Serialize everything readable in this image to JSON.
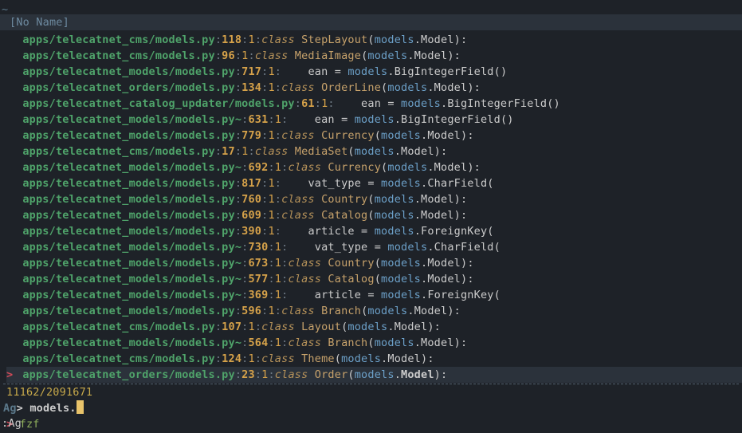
{
  "tilde": "~",
  "title": "[No Name]",
  "rows": [
    {
      "sel": false,
      "path": "apps/telecatnet_cms/models.py",
      "line": "118",
      "col": "1",
      "kind": "cls",
      "pre": "",
      "name": "StepLayout",
      "arg": "Model",
      "tail": ":"
    },
    {
      "sel": false,
      "path": "apps/telecatnet_cms/models.py",
      "line": "96",
      "col": "1",
      "kind": "cls",
      "pre": "",
      "name": "MediaImage",
      "arg": "Model",
      "tail": ":"
    },
    {
      "sel": false,
      "path": "apps/telecatnet_models/models.py",
      "line": "717",
      "col": "1",
      "kind": "assign",
      "pre": "    ",
      "ident": "ean",
      "eq": " = ",
      "attr": "BigIntegerField",
      "tail": "()"
    },
    {
      "sel": false,
      "path": "apps/telecatnet_orders/models.py",
      "line": "134",
      "col": "1",
      "kind": "cls",
      "pre": "",
      "name": "OrderLine",
      "arg": "Model",
      "tail": ":"
    },
    {
      "sel": false,
      "path": "apps/telecatnet_catalog_updater/models.py",
      "line": "61",
      "col": "1",
      "kind": "assign",
      "pre": "    ",
      "ident": "ean",
      "eq": " = ",
      "attr": "BigIntegerField",
      "tail": "()"
    },
    {
      "sel": false,
      "path": "apps/telecatnet_models/models.py~",
      "line": "631",
      "col": "1",
      "kind": "assign",
      "pre": "    ",
      "ident": "ean",
      "eq": " = ",
      "attr": "BigIntegerField",
      "tail": "()"
    },
    {
      "sel": false,
      "path": "apps/telecatnet_models/models.py",
      "line": "779",
      "col": "1",
      "kind": "cls",
      "pre": "",
      "name": "Currency",
      "arg": "Model",
      "tail": ":"
    },
    {
      "sel": false,
      "path": "apps/telecatnet_cms/models.py",
      "line": "17",
      "col": "1",
      "kind": "cls",
      "pre": "",
      "name": "MediaSet",
      "arg": "Model",
      "tail": ":"
    },
    {
      "sel": false,
      "path": "apps/telecatnet_models/models.py~",
      "line": "692",
      "col": "1",
      "kind": "cls",
      "pre": "",
      "name": "Currency",
      "arg": "Model",
      "tail": ":"
    },
    {
      "sel": false,
      "path": "apps/telecatnet_models/models.py",
      "line": "817",
      "col": "1",
      "kind": "assign",
      "pre": "    ",
      "ident": "vat_type",
      "eq": " = ",
      "attr": "CharField",
      "tail": "("
    },
    {
      "sel": false,
      "path": "apps/telecatnet_models/models.py",
      "line": "760",
      "col": "1",
      "kind": "cls",
      "pre": "",
      "name": "Country",
      "arg": "Model",
      "tail": ":"
    },
    {
      "sel": false,
      "path": "apps/telecatnet_models/models.py",
      "line": "609",
      "col": "1",
      "kind": "cls",
      "pre": "",
      "name": "Catalog",
      "arg": "Model",
      "tail": ":"
    },
    {
      "sel": false,
      "path": "apps/telecatnet_models/models.py",
      "line": "390",
      "col": "1",
      "kind": "assign",
      "pre": "    ",
      "ident": "article",
      "eq": " = ",
      "attr": "ForeignKey",
      "tail": "("
    },
    {
      "sel": false,
      "path": "apps/telecatnet_models/models.py~",
      "line": "730",
      "col": "1",
      "kind": "assign",
      "pre": "    ",
      "ident": "vat_type",
      "eq": " = ",
      "attr": "CharField",
      "tail": "("
    },
    {
      "sel": false,
      "path": "apps/telecatnet_models/models.py~",
      "line": "673",
      "col": "1",
      "kind": "cls",
      "pre": "",
      "name": "Country",
      "arg": "Model",
      "tail": ":"
    },
    {
      "sel": false,
      "path": "apps/telecatnet_models/models.py~",
      "line": "577",
      "col": "1",
      "kind": "cls",
      "pre": "",
      "name": "Catalog",
      "arg": "Model",
      "tail": ":"
    },
    {
      "sel": false,
      "path": "apps/telecatnet_models/models.py~",
      "line": "369",
      "col": "1",
      "kind": "assign",
      "pre": "    ",
      "ident": "article",
      "eq": " = ",
      "attr": "ForeignKey",
      "tail": "("
    },
    {
      "sel": false,
      "path": "apps/telecatnet_models/models.py",
      "line": "596",
      "col": "1",
      "kind": "cls",
      "pre": "",
      "name": "Branch",
      "arg": "Model",
      "tail": ":"
    },
    {
      "sel": false,
      "path": "apps/telecatnet_cms/models.py",
      "line": "107",
      "col": "1",
      "kind": "cls",
      "pre": "",
      "name": "Layout",
      "arg": "Model",
      "tail": ":"
    },
    {
      "sel": false,
      "path": "apps/telecatnet_models/models.py~",
      "line": "564",
      "col": "1",
      "kind": "cls",
      "pre": "",
      "name": "Branch",
      "arg": "Model",
      "tail": ":"
    },
    {
      "sel": false,
      "path": "apps/telecatnet_cms/models.py",
      "line": "124",
      "col": "1",
      "kind": "cls",
      "pre": "",
      "name": "Theme",
      "arg": "Model",
      "tail": ":"
    },
    {
      "sel": true,
      "path": "apps/telecatnet_orders/models.py",
      "line": "23",
      "col": "1",
      "kind": "cls",
      "pre": "",
      "name": "Order",
      "arg": "Model",
      "tail": ":"
    }
  ],
  "counter": "11162/2091671",
  "prompt_label": "Ag",
  "prompt_gt": ">",
  "prompt_query": "models.",
  "fzf_prompt": ">",
  "fzf_text": "fzf",
  "cmdline": ":Ag"
}
